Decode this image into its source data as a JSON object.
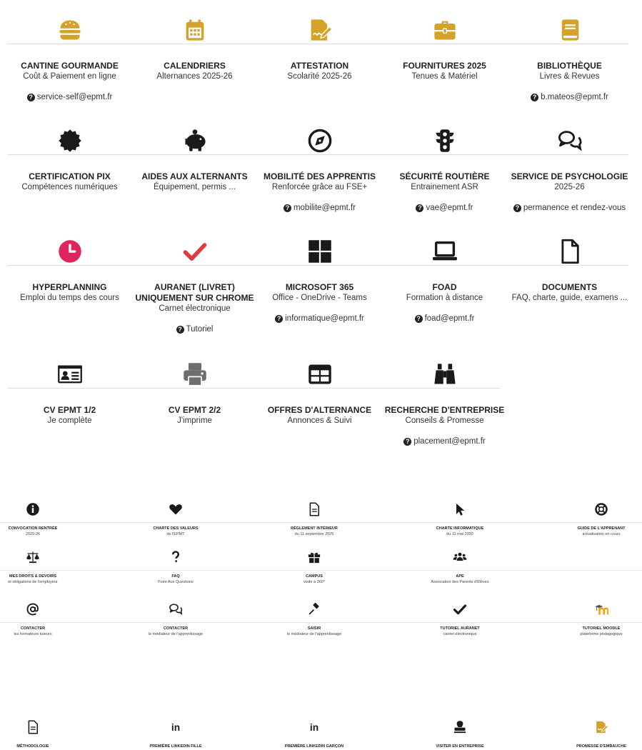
{
  "colors": {
    "gold": "#d4a228",
    "dark": "#1a1a1a",
    "red": "#e2393b",
    "pink": "#e0245e",
    "gray": "#6e6e6e"
  },
  "big_rows": [
    {
      "tiles": [
        {
          "icon": "burger-icon",
          "title": "CANTINE GOURMANDE",
          "subtitle": "Coût & Paiement en ligne",
          "contact": "service-self@epmt.fr"
        },
        {
          "icon": "calendar-icon",
          "title": "CALENDRIERS",
          "subtitle": "Alternances 2025-26",
          "contact": ""
        },
        {
          "icon": "signature-icon",
          "title": "ATTESTATION",
          "subtitle": "Scolarité 2025-26",
          "contact": ""
        },
        {
          "icon": "toolbox-icon",
          "title": "FOURNITURES 2025",
          "subtitle": "Tenues & Matériel",
          "contact": ""
        },
        {
          "icon": "book-icon",
          "title": "BIBLIOTHÈQUE",
          "subtitle": "Livres & Revues",
          "contact": "b.mateos@epmt.fr"
        }
      ]
    },
    {
      "tiles": [
        {
          "icon": "certificate-icon",
          "title": "CERTIFICATION PIX",
          "subtitle": "Compétences numériques",
          "contact": ""
        },
        {
          "icon": "piggy-bank-icon",
          "title": "AIDES AUX ALTERNANTS",
          "subtitle": "Équipement, permis ...",
          "contact": ""
        },
        {
          "icon": "compass-icon",
          "title": "MOBILITÉ DES APPRENTIS",
          "subtitle": "Renforcée grâce au FSE+",
          "contact": "mobilite@epmt.fr"
        },
        {
          "icon": "traffic-light-icon",
          "title": "SÉCURITÉ ROUTIÈRE",
          "subtitle": "Entrainement ASR",
          "contact": "vae@epmt.fr"
        },
        {
          "icon": "comments-icon",
          "title": "SERVICE DE PSYCHOLOGIE",
          "subtitle": "2025-26",
          "contact": "permanence et rendez-vous"
        }
      ]
    },
    {
      "tiles": [
        {
          "icon": "clock-icon",
          "title": "HYPERPLANNING",
          "subtitle": "Emploi du temps des cours",
          "contact": ""
        },
        {
          "icon": "check-icon",
          "title": "AURANET (LIVRET)",
          "title2": "UNIQUEMENT SUR CHROME",
          "subtitle": "Carnet électronique",
          "contact": "Tutoriel"
        },
        {
          "icon": "windows-icon",
          "title": "MICROSOFT 365",
          "subtitle": "Office - OneDrive - Teams",
          "contact": "informatique@epmt.fr"
        },
        {
          "icon": "laptop-icon",
          "title": "FOAD",
          "subtitle": "Formation à distance",
          "contact": "foad@epmt.fr"
        },
        {
          "icon": "file-icon",
          "title": "DOCUMENTS",
          "subtitle": "FAQ, charte, guide, examens ...",
          "contact": ""
        }
      ]
    },
    {
      "tiles": [
        {
          "icon": "id-card-icon",
          "title": "CV EPMT 1/2",
          "subtitle": "Je complète",
          "contact": ""
        },
        {
          "icon": "printer-icon",
          "title": "CV EPMT 2/2",
          "subtitle": "J'imprime",
          "contact": ""
        },
        {
          "icon": "table-icon",
          "title": "OFFRES D'ALTERNANCE",
          "subtitle": "Annonces & Suivi",
          "contact": ""
        },
        {
          "icon": "binoculars-icon",
          "title": "RECHERCHE D'ENTREPRISE",
          "subtitle": "Conseils & Promesse",
          "contact": "placement@epmt.fr"
        }
      ]
    }
  ],
  "small_rows": [
    {
      "tiles": [
        {
          "icon": "info-icon",
          "title": "CONVOCATION RENTRÉE",
          "subtitle": "2025-26"
        },
        {
          "icon": "heart-icon",
          "title": "CHARTE DES VALEURS",
          "subtitle": "de l'EPMT"
        },
        {
          "icon": "document-icon",
          "title": "RÈGLEMENT INTÉRIEUR",
          "subtitle": "du 11 septembre 2025"
        },
        {
          "icon": "cursor-icon",
          "title": "CHARTE INFORMATIQUE",
          "subtitle": "du 11 mai 2020"
        },
        {
          "icon": "lifebuoy-icon",
          "title": "GUIDE DE L'APPRENANT",
          "subtitle": "actualisation en cours"
        }
      ]
    },
    {
      "tiles": [
        {
          "icon": "scales-icon",
          "title": "MES DROITS & DEVOIRS",
          "subtitle": "et obligations de l'employeur"
        },
        {
          "icon": "question-icon",
          "title": "FAQ",
          "subtitle": "Foire Aux Questions"
        },
        {
          "icon": "gift-icon",
          "title": "CAMPUS",
          "subtitle": "visite à 360°"
        },
        {
          "icon": "users-icon",
          "title": "APE",
          "subtitle": "Association des Parents d'Élèves"
        }
      ]
    },
    {
      "tiles": [
        {
          "icon": "at-icon",
          "title": "CONTACTER",
          "subtitle": "les formateurs tuteurs"
        },
        {
          "icon": "comments-icon",
          "title": "CONTACTER",
          "subtitle": "le médiateur de l'apprentissage"
        },
        {
          "icon": "gavel-icon",
          "title": "SAISIR",
          "subtitle": "le médiateur de l'apprentissage"
        },
        {
          "icon": "check-icon",
          "title": "TUTORIEL AURANET",
          "subtitle": "carnet électronique"
        },
        {
          "icon": "moodle-icon",
          "title": "TUTORIEL MOODLE",
          "subtitle": "plateforme pédagogique"
        }
      ]
    },
    {
      "tiles": [
        {
          "icon": "document-icon",
          "title": "Méthodologie",
          "subtitle": ""
        },
        {
          "icon": "linkedin-icon",
          "title": "Première LinkedIn Fille",
          "subtitle": ""
        },
        {
          "icon": "linkedin-icon",
          "title": "Première LinkedIn Garçon",
          "subtitle": ""
        },
        {
          "icon": "stamp-icon",
          "title": "Visiter en entreprise",
          "subtitle": ""
        },
        {
          "icon": "signature-icon",
          "title": "Promesse d'embauche",
          "subtitle": ""
        }
      ]
    }
  ]
}
